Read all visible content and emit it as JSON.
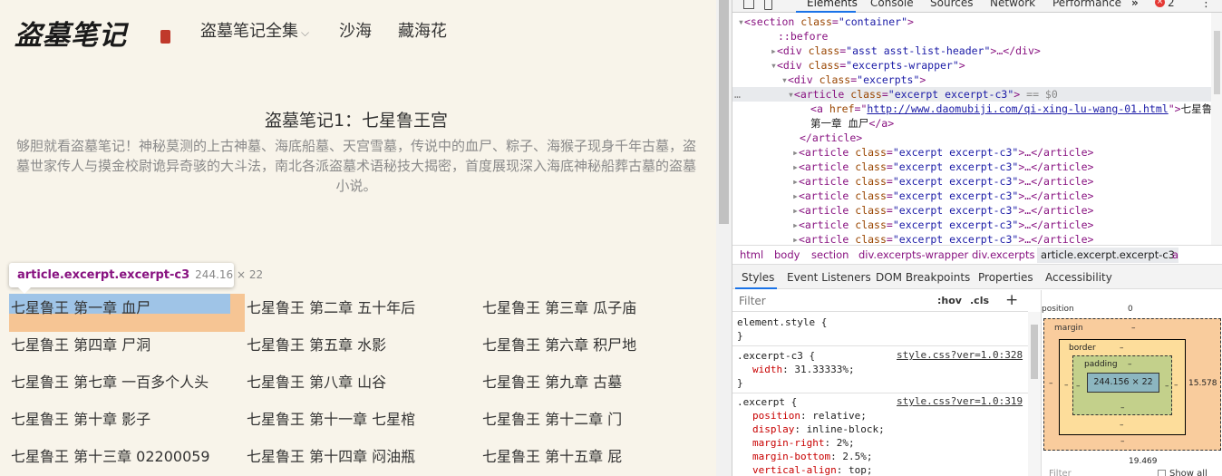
{
  "site": {
    "logo": "盗墓笔记",
    "nav": [
      "盗墓笔记全集",
      "沙海",
      "藏海花"
    ],
    "nav_caret": "⌵",
    "book_title": "盗墓笔记1：七星鲁王宫",
    "book_desc": "够胆就看盗墓笔记！神秘莫测的上古神墓、海底船墓、天宫雪墓，传说中的血尸、粽子、海猴子现身千年古墓，盗墓世家传人与摸金校尉诡异奇骇的大斗法，南北各派盗墓术语秘技大揭密，首度展现深入海底神秘船葬古墓的盗墓小说。",
    "tooltip_selector": "article.excerpt.excerpt-c3",
    "tooltip_dims": "244.16 × 22",
    "chapters": [
      [
        "七星鲁王 第一章 血尸",
        "七星鲁王 第二章 五十年后",
        "七星鲁王 第三章 瓜子庙"
      ],
      [
        "七星鲁王 第四章 尸洞",
        "七星鲁王 第五章 水影",
        "七星鲁王 第六章 积尸地"
      ],
      [
        "七星鲁王 第七章 一百多个人头",
        "七星鲁王 第八章 山谷",
        "七星鲁王 第九章 古墓"
      ],
      [
        "七星鲁王 第十章 影子",
        "七星鲁王 第十一章 七星棺",
        "七星鲁王 第十二章 门"
      ],
      [
        "七星鲁王 第十三章 02200059",
        "七星鲁王 第十四章 闷油瓶",
        "七星鲁王 第十五章 屁"
      ]
    ]
  },
  "devtools": {
    "tabs": [
      "Elements",
      "Console",
      "Sources",
      "Network",
      "Performance"
    ],
    "more": "»",
    "error_count": "2",
    "settings": "⋮",
    "dom": {
      "l1": {
        "arrow": "▾",
        "open": "<",
        "tag": "section",
        "attr": "class",
        "val": "\"container\"",
        "close": ">"
      },
      "l2": "::before",
      "l3": {
        "arrow": "▸",
        "tag": "div",
        "attr": "class",
        "val": "\"asst asst-list-header\"",
        "rest": "…</div>"
      },
      "l4": {
        "arrow": "▾",
        "tag": "div",
        "attr": "class",
        "val": "\"excerpts-wrapper\""
      },
      "l5": {
        "arrow": "▾",
        "tag": "div",
        "attr": "class",
        "val": "\"excerpts\""
      },
      "l6": {
        "dots": "…",
        "arrow": "▾",
        "tag": "article",
        "attr": "class",
        "val": "\"excerpt excerpt-c3\"",
        "eq": "== $0"
      },
      "l7": {
        "tag": "a",
        "attr": "href",
        "url": "http://www.daomubiji.com/qi-xing-lu-wang-01.html",
        "text1": "七星鲁王",
        "text2": "第一章 血尸",
        "close_tag": "</a>"
      },
      "l8": "</article>",
      "collapsed": {
        "arrow": "▸",
        "tag": "article",
        "attr": "class",
        "val": "\"excerpt excerpt-c3\"",
        "rest": "…</article>"
      }
    },
    "breadcrumbs": [
      "html",
      "body",
      "section",
      "div.excerpts-wrapper",
      "div.excerpts",
      "article.excerpt.excerpt-c3",
      "a"
    ],
    "subtabs": [
      "Styles",
      "Event Listeners",
      "DOM Breakpoints",
      "Properties",
      "Accessibility"
    ],
    "filter_placeholder": "Filter",
    "hov": ":hov",
    "cls": ".cls",
    "plus": "+",
    "rules": {
      "r1_sel": "element.style {",
      "r1_close": "}",
      "r2_sel": ".excerpt-c3 {",
      "r2_src": "style.css?ver=1.0:328",
      "r2_props": [
        {
          "name": "width",
          "value": "31.33333%;"
        }
      ],
      "r2_close": "}",
      "r3_sel": ".excerpt {",
      "r3_src": "style.css?ver=1.0:319",
      "r3_props": [
        {
          "name": "position",
          "value": "relative;"
        },
        {
          "name": "display",
          "value": "inline-block;"
        },
        {
          "name": "margin-right",
          "value": "2%;"
        },
        {
          "name": "margin-bottom",
          "value": "2.5%;"
        },
        {
          "name": "vertical-align",
          "value": "top;"
        }
      ]
    },
    "boxmodel": {
      "position_label": "position",
      "position_value": "0",
      "margin_label": "margin",
      "margin_top": "–",
      "margin_right": "15.578",
      "margin_bottom": "–",
      "margin_left": "–",
      "margin_bottom_val": "19.469",
      "border_label": "border",
      "border_top": "–",
      "border_right": "–",
      "border_bottom": "–",
      "border_left": "–",
      "padding_label": "padding",
      "padding_top": "–",
      "padding_right": "–",
      "padding_bottom": "–",
      "padding_left": "–",
      "content": "244.156 × 22",
      "filter": "Filter",
      "show_all": "Show all"
    }
  }
}
